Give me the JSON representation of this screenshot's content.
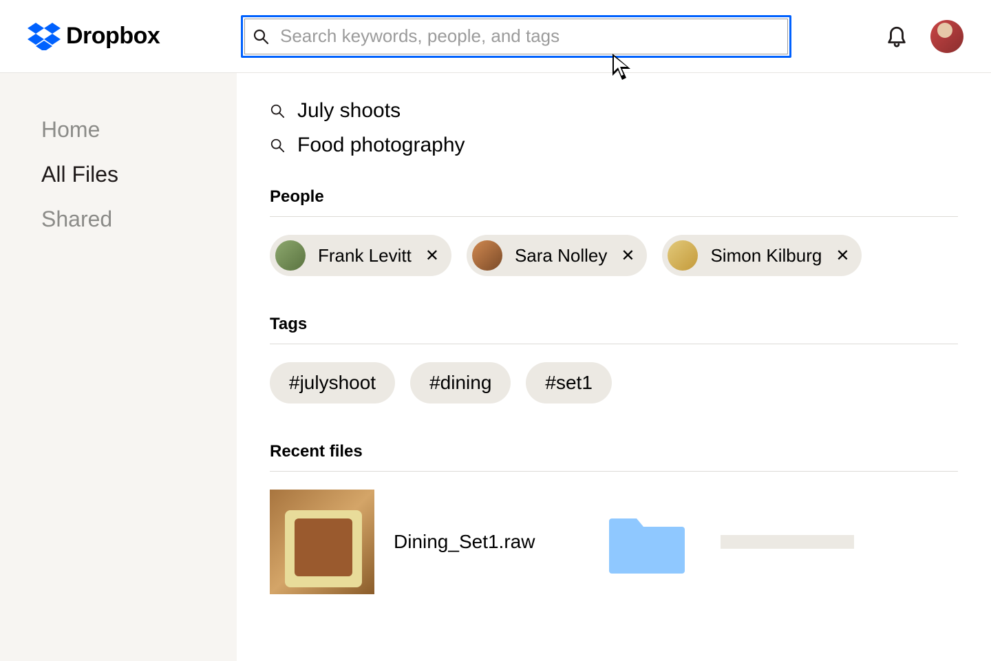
{
  "brand": {
    "name": "Dropbox"
  },
  "search": {
    "placeholder": "Search keywords, people, and tags",
    "value": ""
  },
  "sidebar": {
    "items": [
      {
        "label": "Home",
        "active": false
      },
      {
        "label": "All Files",
        "active": true
      },
      {
        "label": "Shared",
        "active": false
      }
    ]
  },
  "suggestions": [
    {
      "label": "July shoots"
    },
    {
      "label": "Food photography"
    }
  ],
  "sections": {
    "people_title": "People",
    "tags_title": "Tags",
    "recent_title": "Recent files"
  },
  "people": [
    {
      "name": "Frank Levitt"
    },
    {
      "name": "Sara Nolley"
    },
    {
      "name": "Simon Kilburg"
    }
  ],
  "tags": [
    {
      "label": "#julyshoot"
    },
    {
      "label": "#dining"
    },
    {
      "label": "#set1"
    }
  ],
  "recent": [
    {
      "name": "Dining_Set1.raw",
      "type": "image"
    },
    {
      "name": "",
      "type": "folder"
    }
  ],
  "icons": {
    "close_glyph": "✕"
  }
}
